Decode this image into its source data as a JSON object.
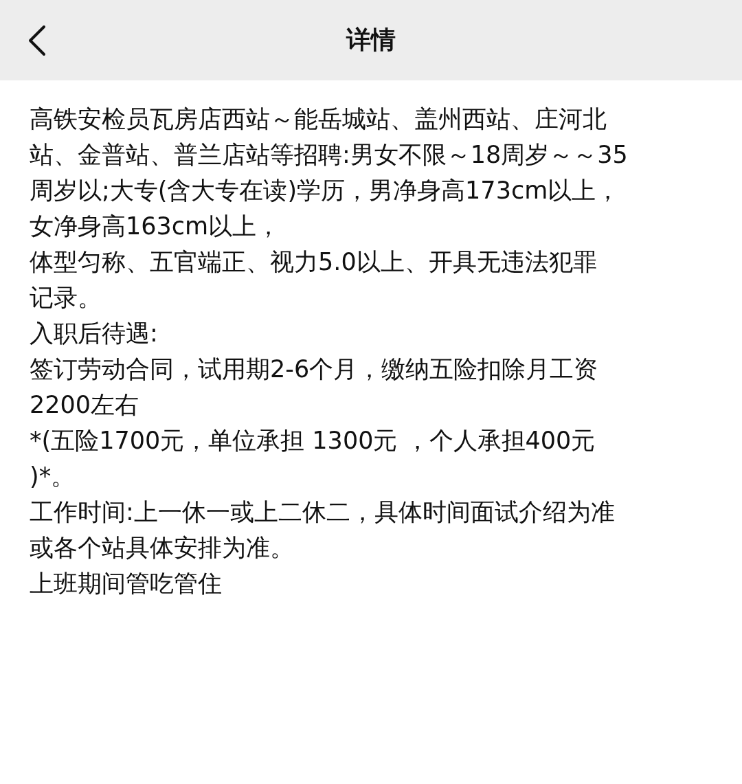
{
  "nav_bar": {
    "title": "详情"
  },
  "content_lines": [
    "高铁安检员瓦房店西站～能岳城站、盖州西站、庄河北",
    "站、金普站、普兰店站等招聘:男女不限～18周岁～～35",
    "周岁以;大专(含大专在读)学历，男净身高173cm以上，",
    "女净身高163cm以上，",
    "体型匀称、五官端正、视力5.0以上、开具无违法犯罪",
    "记录。",
    "入职后待遇:",
    "签订劳动合同，试用期2-6个月，缴纳五险扣除月工资",
    "2200左右",
    "*(五险1700元，单位承担 1300元 ，个人承担400元",
    ")*。",
    "工作时间:上一休一或上二休二，具体时间面试介绍为准",
    "或各个站具体安排为准。",
    "上班期间管吃管住"
  ]
}
